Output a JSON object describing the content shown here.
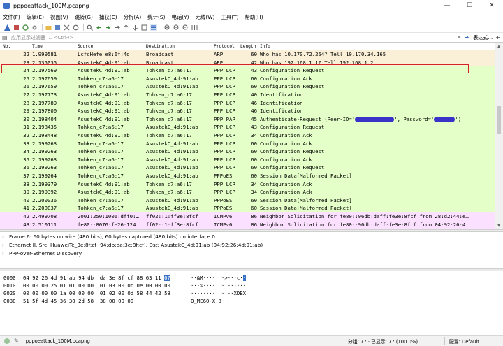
{
  "window": {
    "title": "pppoeattack_100M.pcapng",
    "minimize": "—",
    "maximize": "☐",
    "close": "✕"
  },
  "menu": [
    "文件(F)",
    "编辑(E)",
    "视图(V)",
    "跳转(G)",
    "捕获(C)",
    "分析(A)",
    "统计(S)",
    "电话(Y)",
    "无线(W)",
    "工具(T)",
    "帮助(H)"
  ],
  "filter": {
    "placeholder": "应用显示过滤器 … <Ctrl-/>",
    "expression_label": "表达式…",
    "add": "+"
  },
  "columns": {
    "no": "No.",
    "time": "Time",
    "source": "Source",
    "destination": "Destination",
    "protocol": "Protocol",
    "length": "Length",
    "info": "Info"
  },
  "rows": [
    {
      "no": "22",
      "time": "1.999581",
      "src": "LcfcHefe_e8:6f:4d",
      "dst": "Broadcast",
      "proto": "ARP",
      "len": "60",
      "info": "Who has 10.170.72.254? Tell 10.170.34.165",
      "bg": "#faf0d7"
    },
    {
      "no": "23",
      "time": "2.135035",
      "src": "AsustekC_4d:91:ab",
      "dst": "Broadcast",
      "proto": "ARP",
      "len": "42",
      "info": "Who has 192.168.1.1? Tell 192.168.1.2",
      "bg": "#faf0d7"
    },
    {
      "no": "24",
      "time": "2.197569",
      "src": "AsustekC_4d:91:ab",
      "dst": "Tohken_c7:a6:17",
      "proto": "PPP LCP",
      "len": "43",
      "info": "Configuration Request",
      "bg": "#e4ffc7"
    },
    {
      "no": "25",
      "time": "2.197659",
      "src": "Tohken_c7:a6:17",
      "dst": "AsustekC_4d:91:ab",
      "proto": "PPP LCP",
      "len": "60",
      "info": "Configuration Ack",
      "bg": "#e4ffc7"
    },
    {
      "no": "26",
      "time": "2.197659",
      "src": "Tohken_c7:a6:17",
      "dst": "AsustekC_4d:91:ab",
      "proto": "PPP LCP",
      "len": "60",
      "info": "Configuration Request",
      "bg": "#e4ffc7"
    },
    {
      "no": "27",
      "time": "2.197773",
      "src": "AsustekC_4d:91:ab",
      "dst": "Tohken_c7:a6:17",
      "proto": "PPP LCP",
      "len": "40",
      "info": "Identification",
      "bg": "#e4ffc7"
    },
    {
      "no": "28",
      "time": "2.197789",
      "src": "AsustekC_4d:91:ab",
      "dst": "Tohken_c7:a6:17",
      "proto": "PPP LCP",
      "len": "46",
      "info": "Identification",
      "bg": "#e4ffc7"
    },
    {
      "no": "29",
      "time": "2.197800",
      "src": "AsustekC_4d:91:ab",
      "dst": "Tohken_c7:a6:17",
      "proto": "PPP LCP",
      "len": "46",
      "info": "Identification",
      "bg": "#e4ffc7"
    },
    {
      "no": "30",
      "time": "2.198404",
      "src": "AsustekC_4d:91:ab",
      "dst": "Tohken_c7:a6:17",
      "proto": "PPP PAP",
      "len": "45",
      "info": "Authenticate-Request (Peer-ID='",
      "info_mid": "', Password='",
      "info_end": "')",
      "bg": "#e4ffc7",
      "redacted": true
    },
    {
      "no": "31",
      "time": "2.198435",
      "src": "Tohken_c7:a6:17",
      "dst": "AsustekC_4d:91:ab",
      "proto": "PPP LCP",
      "len": "43",
      "info": "Configuration Request",
      "bg": "#e4ffc7"
    },
    {
      "no": "32",
      "time": "2.198448",
      "src": "AsustekC_4d:91:ab",
      "dst": "Tohken_c7:a6:17",
      "proto": "PPP LCP",
      "len": "34",
      "info": "Configuration Ack",
      "bg": "#e4ffc7"
    },
    {
      "no": "33",
      "time": "2.199263",
      "src": "Tohken_c7:a6:17",
      "dst": "AsustekC_4d:91:ab",
      "proto": "PPP LCP",
      "len": "60",
      "info": "Configuration Ack",
      "bg": "#e4ffc7"
    },
    {
      "no": "34",
      "time": "2.199263",
      "src": "Tohken_c7:a6:17",
      "dst": "AsustekC_4d:91:ab",
      "proto": "PPP LCP",
      "len": "60",
      "info": "Configuration Request",
      "bg": "#e4ffc7"
    },
    {
      "no": "35",
      "time": "2.199263",
      "src": "Tohken_c7:a6:17",
      "dst": "AsustekC_4d:91:ab",
      "proto": "PPP LCP",
      "len": "60",
      "info": "Configuration Ack",
      "bg": "#e4ffc7"
    },
    {
      "no": "36",
      "time": "2.199263",
      "src": "Tohken_c7:a6:17",
      "dst": "AsustekC_4d:91:ab",
      "proto": "PPP LCP",
      "len": "60",
      "info": "Configuration Request",
      "bg": "#e4ffc7"
    },
    {
      "no": "37",
      "time": "2.199264",
      "src": "Tohken_c7:a6:17",
      "dst": "AsustekC_4d:91:ab",
      "proto": "PPPoES",
      "len": "60",
      "info": "Session Data[Malformed Packet]",
      "bg": "#e4ffc7"
    },
    {
      "no": "38",
      "time": "2.199379",
      "src": "AsustekC_4d:91:ab",
      "dst": "Tohken_c7:a6:17",
      "proto": "PPP LCP",
      "len": "34",
      "info": "Configuration Ack",
      "bg": "#e4ffc7"
    },
    {
      "no": "39",
      "time": "2.199392",
      "src": "AsustekC_4d:91:ab",
      "dst": "Tohken_c7:a6:17",
      "proto": "PPP LCP",
      "len": "34",
      "info": "Configuration Ack",
      "bg": "#e4ffc7"
    },
    {
      "no": "40",
      "time": "2.200036",
      "src": "Tohken_c7:a6:17",
      "dst": "AsustekC_4d:91:ab",
      "proto": "PPPoES",
      "len": "60",
      "info": "Session Data[Malformed Packet]",
      "bg": "#e4ffc7"
    },
    {
      "no": "41",
      "time": "2.200037",
      "src": "Tohken_c7:a6:17",
      "dst": "AsustekC_4d:91:ab",
      "proto": "PPPoES",
      "len": "60",
      "info": "Session Data[Malformed Packet]",
      "bg": "#e4ffc7"
    },
    {
      "no": "42",
      "time": "2.499708",
      "src": "2001:250:1006:dff0:…",
      "dst": "ff02::1:ff3e:8fcf",
      "proto": "ICMPv6",
      "len": "86",
      "info": "Neighbor Solicitation for fe80::96db:daff:fe3e:8fcf from 28:d2:44:e…",
      "bg": "#fce0ff"
    },
    {
      "no": "43",
      "time": "2.510111",
      "src": "fe80::8076:fe26:124…",
      "dst": "ff02::1:ff3e:8fcf",
      "proto": "ICMPv6",
      "len": "86",
      "info": "Neighbor Solicitation for fe80::96db:daff:fe3e:8fcf from 04:92:26:4…",
      "bg": "#fce0ff"
    }
  ],
  "details": [
    "Frame 6: 60 bytes on wire (480 bits), 60 bytes captured (480 bits) on interface 0",
    "Ethernet II, Src: HuaweiTe_3e:8f:cf (94:db:da:3e:8f:cf), Dst: AsustekC_4d:91:ab (04:92:26:4d:91:ab)",
    "PPP-over-Ethernet Discovery"
  ],
  "bytes": [
    {
      "off": "0000",
      "hex_a": "04 92 26 4d 91 ab 94 db  da 3e 8f cf 88 63 11 ",
      "hex_sel": "07",
      "asc_a": "··&M····  ·>···c·",
      "asc_sel": "·"
    },
    {
      "off": "0010",
      "hex_a": "00 00 00 25 01 01 00 00  01 03 00 0c 0e 00 00 00",
      "hex_sel": "",
      "asc_a": "···%····  ········",
      "asc_sel": ""
    },
    {
      "off": "0020",
      "hex_a": "00 00 00 00 1a 00 00 00  01 02 00 0d 58 44 42 58",
      "hex_sel": "",
      "asc_a": "········  ····XDBX",
      "asc_sel": ""
    },
    {
      "off": "0030",
      "hex_a": "51 5f 4d 45 36 30 2d 58  38 00 00 00",
      "hex_sel": "",
      "asc_a": "Q_ME60-X 8···",
      "asc_sel": ""
    }
  ],
  "status": {
    "file": "pppoeattack_100M.pcapng",
    "counts": "分组: 77 · 已显示: 77 (100.0%)",
    "profile": "配置: Default"
  },
  "colors": {
    "arp_row": "#faf0d7",
    "ppp_row": "#e4ffc7",
    "icmpv6_row": "#fce0ff",
    "highlight_border": "#d32424",
    "selection": "#3571c6"
  }
}
